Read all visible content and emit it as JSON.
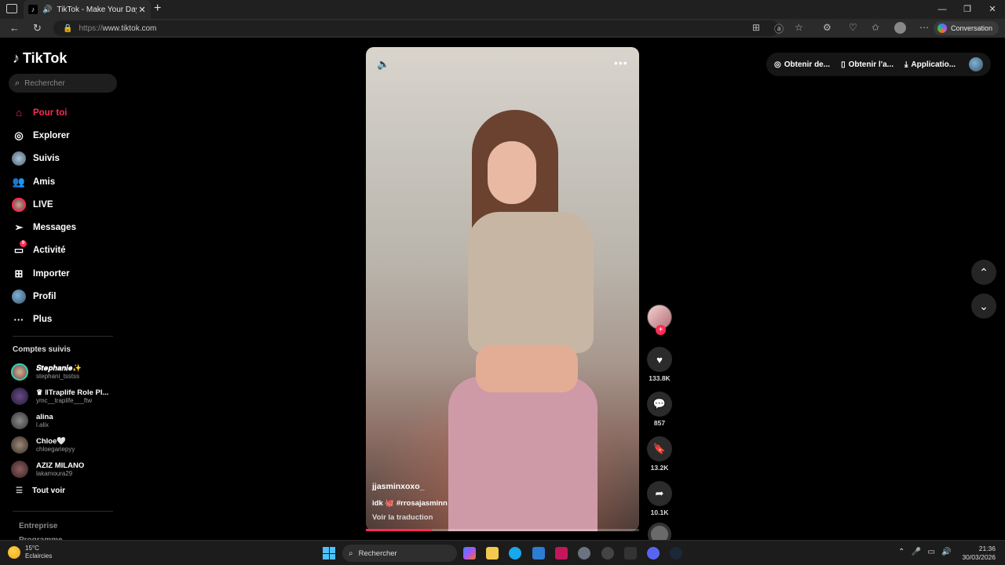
{
  "browser": {
    "tab_title": "TikTok - Make Your Day",
    "url_protocol": "https://",
    "url_host": "www.tiktok.com",
    "copilot_label": "Conversation"
  },
  "sidebar": {
    "logo": "TikTok",
    "search_placeholder": "Rechercher",
    "nav": [
      {
        "label": "Pour toi",
        "icon": "home-icon",
        "active": true
      },
      {
        "label": "Explorer",
        "icon": "compass-icon"
      },
      {
        "label": "Suivis",
        "icon": "following-avatar-icon"
      },
      {
        "label": "Amis",
        "icon": "friends-icon"
      },
      {
        "label": "LIVE",
        "icon": "live-icon"
      },
      {
        "label": "Messages",
        "icon": "send-icon"
      },
      {
        "label": "Activité",
        "icon": "activity-icon",
        "badge": "9"
      },
      {
        "label": "Importer",
        "icon": "upload-icon"
      },
      {
        "label": "Profil",
        "icon": "profile-avatar-icon"
      },
      {
        "label": "Plus",
        "icon": "more-icon"
      }
    ],
    "following_heading": "Comptes suivis",
    "following": [
      {
        "name": "𝑺𝒕𝒆𝒑𝒉𝒂𝒏𝒊𝒆✨",
        "username": "stephani_tsstss",
        "color": "#8a6a5a"
      },
      {
        "name": "♛ ‖Traplife Role Pl...",
        "username": "ymc__traplife___ftw",
        "color": "#3a2a5a"
      },
      {
        "name": "alina",
        "username": "l.alix",
        "color": "#555555"
      },
      {
        "name": "Chloe🤍",
        "username": "chloegariepyy",
        "color": "#6a5a4a"
      },
      {
        "name": "AZIZ MILANO",
        "username": "lakamoura29",
        "color": "#5a4040"
      }
    ],
    "see_all": "Tout voir",
    "footer": [
      "Entreprise",
      "Programme"
    ]
  },
  "video": {
    "username": "jjasminxoxo_",
    "description": "idk 🐙 #rrosajasminn",
    "translate": "Voir la traduction",
    "progress_percent": 24
  },
  "actions": {
    "likes": "133.8K",
    "comments": "857",
    "saves": "13.2K",
    "shares": "10.1K"
  },
  "topright": {
    "coins": "Obtenir de...",
    "app": "Obtenir l'a...",
    "download": "Applicatio..."
  },
  "taskbar": {
    "temperature": "15°C",
    "weather": "Eclaircies",
    "search": "Rechercher",
    "time": "21:36",
    "date": "30/03/2026"
  }
}
